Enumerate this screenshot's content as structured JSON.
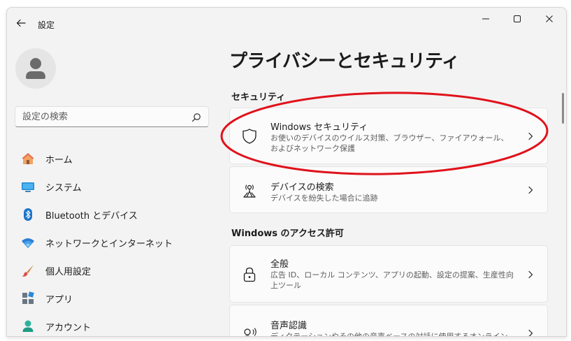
{
  "app": {
    "title": "設定"
  },
  "search": {
    "placeholder": "設定の検索"
  },
  "sidebar": {
    "items": [
      {
        "label": "ホーム",
        "icon": "home-icon"
      },
      {
        "label": "システム",
        "icon": "system-icon"
      },
      {
        "label": "Bluetooth とデバイス",
        "icon": "bluetooth-icon"
      },
      {
        "label": "ネットワークとインターネット",
        "icon": "network-icon"
      },
      {
        "label": "個人用設定",
        "icon": "personalization-icon"
      },
      {
        "label": "アプリ",
        "icon": "apps-icon"
      },
      {
        "label": "アカウント",
        "icon": "account-icon"
      }
    ]
  },
  "main": {
    "title": "プライバシーとセキュリティ",
    "sections": [
      {
        "label": "セキュリティ",
        "cards": [
          {
            "title": "Windows セキュリティ",
            "desc": "お使いのデバイスのウイルス対策、ブラウザー、ファイアウォール、およびネットワーク保護",
            "icon": "shield-icon"
          },
          {
            "title": "デバイスの検索",
            "desc": "デバイスを紛失した場合に追跡",
            "icon": "find-device-icon"
          }
        ]
      },
      {
        "label": "Windows のアクセス許可",
        "cards": [
          {
            "title": "全般",
            "desc": "広告 ID、ローカル コンテンツ、アプリの起動、設定の提案、生産性向上ツール",
            "icon": "lock-icon"
          },
          {
            "title": "音声認識",
            "desc": "ディクテーションやその他の音声ベースの対話に使用するオンライン音声認識",
            "icon": "speech-icon"
          }
        ]
      }
    ]
  },
  "colors": {
    "accent": "#0067c0",
    "highlight": "#e0121b",
    "background": "#f3f3f3",
    "card": "#fbfbfb"
  }
}
